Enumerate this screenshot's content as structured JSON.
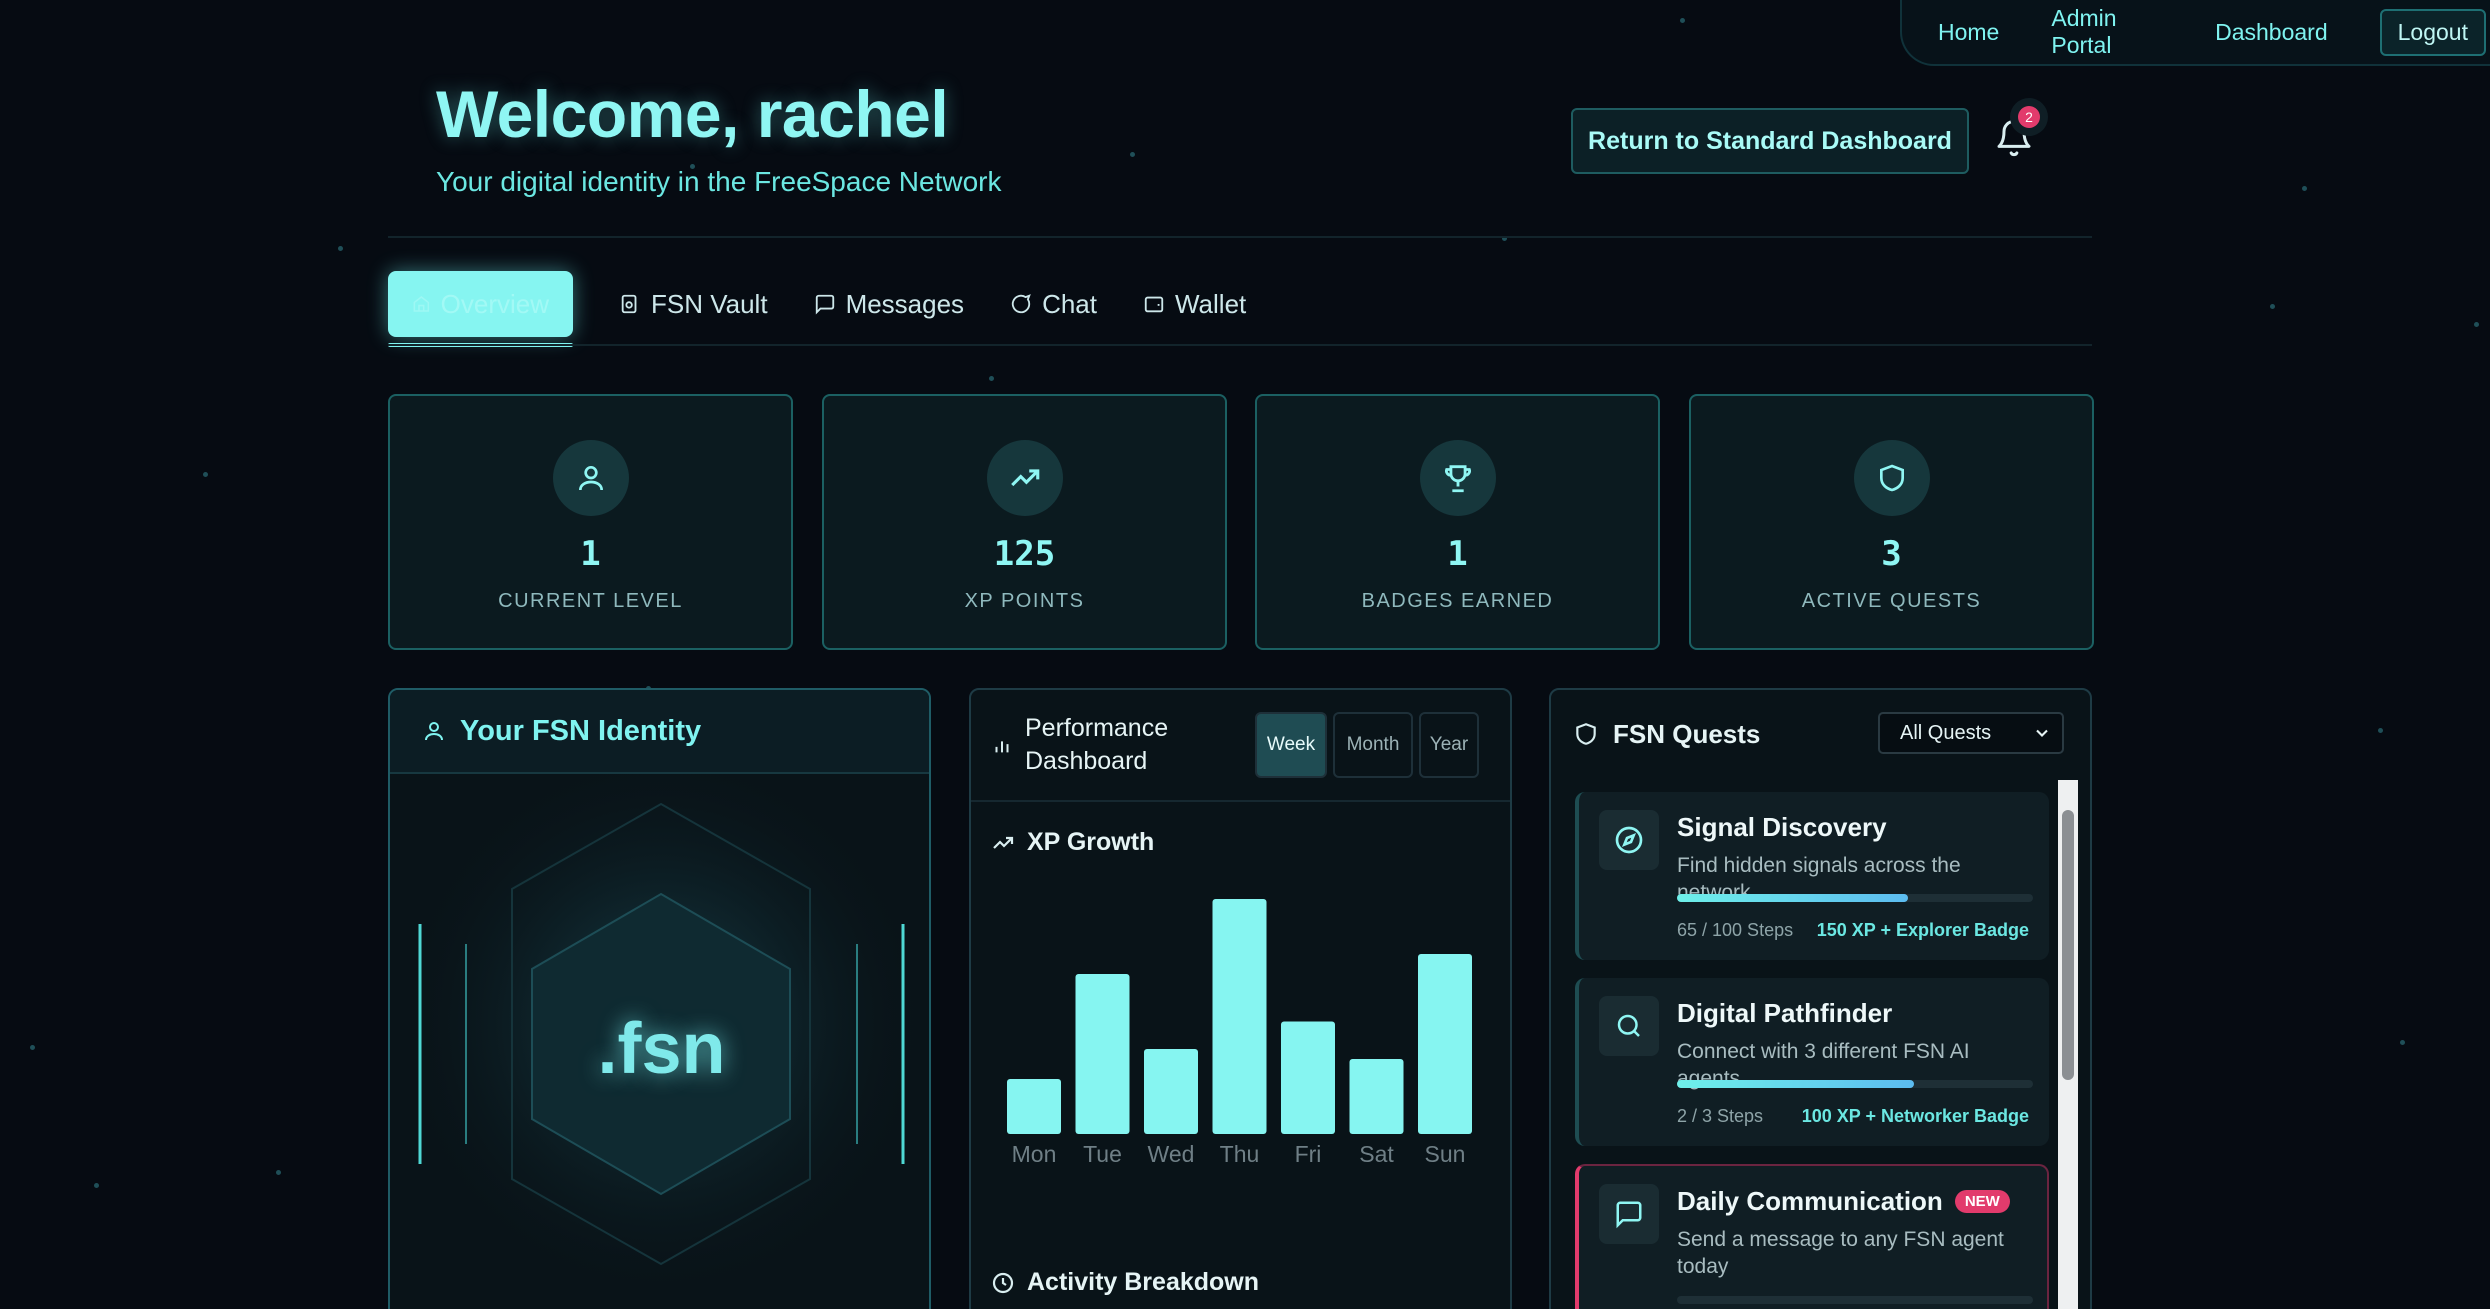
{
  "nav": {
    "home": "Home",
    "admin": "Admin Portal",
    "dashboard": "Dashboard",
    "logout": "Logout"
  },
  "header": {
    "welcome": "Welcome, rachel",
    "subtitle": "Your digital identity in the FreeSpace Network",
    "return_button": "Return to Standard Dashboard",
    "notifications_count": "2"
  },
  "tabs": [
    {
      "label": "Overview",
      "icon": "home-icon",
      "active": true
    },
    {
      "label": "FSN Vault",
      "icon": "vault-icon"
    },
    {
      "label": "Messages",
      "icon": "message-square-icon"
    },
    {
      "label": "Chat",
      "icon": "chat-bubble-icon"
    },
    {
      "label": "Wallet",
      "icon": "wallet-icon"
    }
  ],
  "stats": [
    {
      "value": "1",
      "label": "CURRENT LEVEL",
      "icon": "user-icon"
    },
    {
      "value": "125",
      "label": "XP POINTS",
      "icon": "trending-up-icon"
    },
    {
      "value": "1",
      "label": "BADGES EARNED",
      "icon": "trophy-icon"
    },
    {
      "value": "3",
      "label": "ACTIVE QUESTS",
      "icon": "shield-icon"
    }
  ],
  "identity": {
    "title": "Your FSN Identity",
    "domain": ".fsn"
  },
  "performance": {
    "title": "Performance Dashboard",
    "ranges": [
      "Week",
      "Month",
      "Year"
    ],
    "selected_range": "Week",
    "xp_title": "XP Growth",
    "activity_title": "Activity Breakdown"
  },
  "chart_data": {
    "type": "bar",
    "title": "XP Growth",
    "categories": [
      "Mon",
      "Tue",
      "Wed",
      "Thu",
      "Fri",
      "Sat",
      "Sun"
    ],
    "values": [
      22,
      64,
      34,
      94,
      45,
      30,
      72
    ],
    "ylim": [
      0,
      100
    ],
    "xlabel": "",
    "ylabel": "",
    "grid": false,
    "color": "#86f5f1"
  },
  "quests": {
    "title": "FSN Quests",
    "filter": "All Quests",
    "items": [
      {
        "title": "Signal Discovery",
        "description": "Find hidden signals across the network",
        "steps": "65 / 100 Steps",
        "reward": "150 XP + Explorer Badge",
        "progress": 0.65,
        "icon": "compass-icon"
      },
      {
        "title": "Digital Pathfinder",
        "description": "Connect with 3 different FSN AI agents",
        "steps": "2 / 3 Steps",
        "reward": "100 XP + Networker Badge",
        "progress": 0.667,
        "icon": "search-icon"
      },
      {
        "title": "Daily Communication",
        "badge": "NEW",
        "description": "Send a message to any FSN agent today",
        "progress": 0,
        "icon": "message-square-icon"
      }
    ]
  },
  "colors": {
    "accent": "#86f5f1",
    "background": "#060b12",
    "badge": "#e23b6c"
  }
}
